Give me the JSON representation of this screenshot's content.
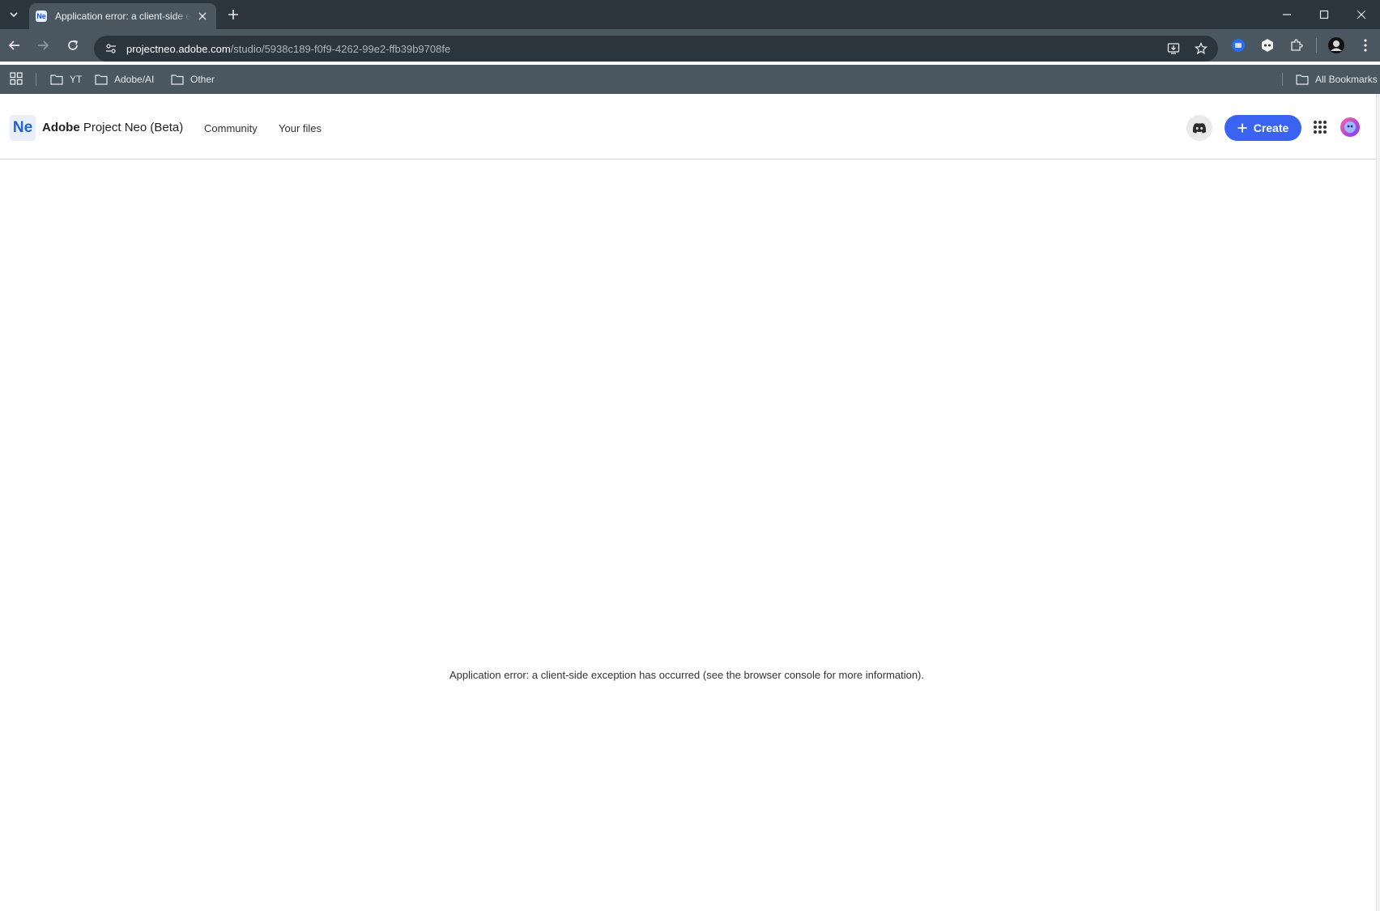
{
  "browser": {
    "tab": {
      "favicon_text": "Ne",
      "title": "Application error: a client-side exception has occurred"
    },
    "url": {
      "host": "projectneo.adobe.com",
      "path": "/studio/5938c189-f0f9-4262-99e2-ffb39b9708fe"
    },
    "bookmarks": [
      {
        "label": "YT"
      },
      {
        "label": "Adobe/AI"
      },
      {
        "label": "Other"
      }
    ],
    "all_bookmarks_label": "All Bookmarks"
  },
  "app": {
    "logo_text": "Ne",
    "brand_bold": "Adobe",
    "brand_rest": " Project Neo (Beta)",
    "nav": {
      "community": "Community",
      "your_files": "Your files"
    },
    "create_label": "Create",
    "accent_color": "#3b63f2"
  },
  "main": {
    "error_message": "Application error: a client-side exception has occurred (see the browser console for more information)."
  }
}
